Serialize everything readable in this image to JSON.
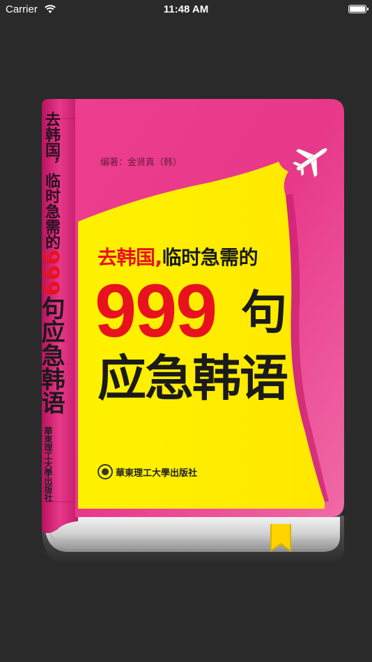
{
  "status_bar": {
    "carrier": "Carrier",
    "time": "11:48 AM"
  },
  "book": {
    "author": "编著：金贤真（韩）",
    "title_line1_red": "去韩国,",
    "title_line1_black": "临时急需的",
    "title_number": "999",
    "title_measure": "句",
    "title_line3": "应急韩语",
    "publisher": "華東理工大學出版社",
    "spine_subtitle": "去韩国，临时急需的",
    "spine_number": "999",
    "spine_title": "句应急韩语",
    "spine_publisher": "華東理工大學出版社",
    "icons": [
      "airplane-icon",
      "bookmark-ribbon",
      "publisher-logo-icon"
    ],
    "colors": {
      "cover_pink": "#e8388a",
      "cover_yellow": "#fff200",
      "title_red": "#e8121e",
      "background": "#2a2a2a"
    }
  }
}
